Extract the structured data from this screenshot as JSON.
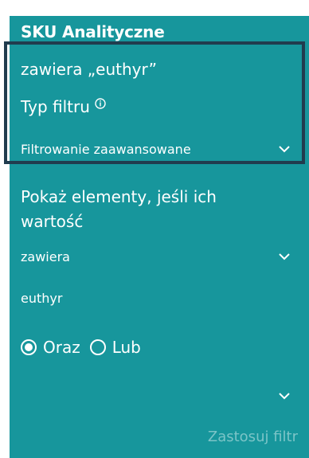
{
  "card": {
    "title": "SKU Analityczne",
    "summary": "zawiera „euthyr”"
  },
  "filter_type": {
    "label": "Typ filtru",
    "info_icon": "info-icon",
    "selected": "Filtrowanie zaawansowane"
  },
  "condition": {
    "label": "Pokaż elementy, jeśli ich wartość",
    "operator": "zawiera",
    "value": "euthyr"
  },
  "logic": {
    "and_label": "Oraz",
    "or_label": "Lub",
    "selected": "Oraz"
  },
  "second_condition": {
    "operator": ""
  },
  "actions": {
    "apply_label": "Zastosuj filtr"
  },
  "colors": {
    "panel_bg": "#17969c",
    "highlight_border": "#213c4e",
    "text": "#ffffff",
    "disabled_text": "#7bc4c7"
  }
}
